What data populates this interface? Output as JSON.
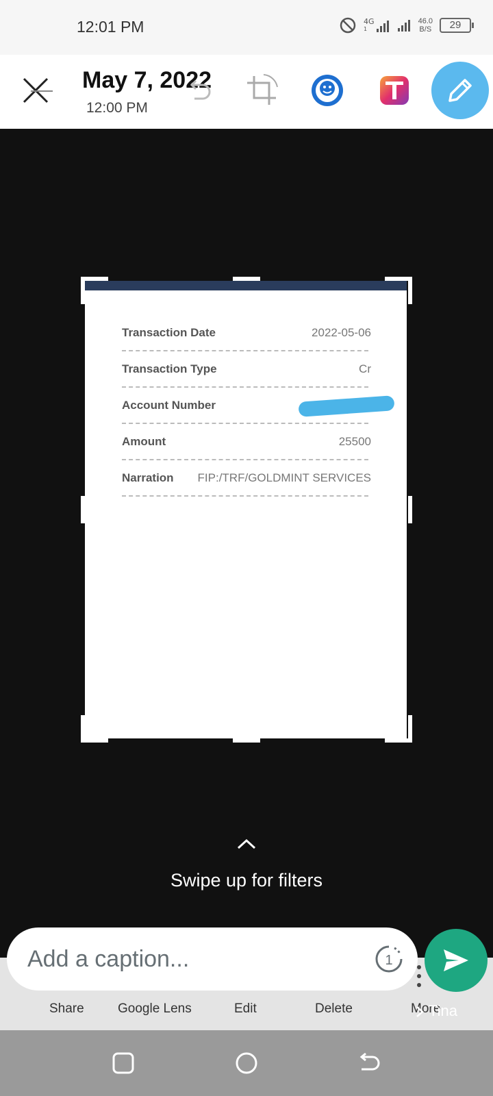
{
  "status_bar": {
    "time": "12:01 PM",
    "network_1": "4G",
    "network_sub": "1",
    "speed_value": "46.0",
    "speed_unit": "B/S",
    "battery": "29"
  },
  "header": {
    "date": "May 7, 2022",
    "time": "12:00 PM",
    "icons": [
      "close-icon",
      "undo-icon",
      "crop-rotate-icon",
      "sticker-icon",
      "text-icon",
      "pencil-icon"
    ],
    "accent_color": "#5bb9ee"
  },
  "document": {
    "rows": [
      {
        "label": "Transaction Date",
        "value": "2022-05-06"
      },
      {
        "label": "Transaction Type",
        "value": "Cr"
      },
      {
        "label": "Account Number",
        "value": ""
      },
      {
        "label": "Amount",
        "value": "25500"
      },
      {
        "label": "Narration",
        "value": "FIP:/TRF/GOLDMINT SERVICES"
      }
    ],
    "redaction_color": "#4bb4e8"
  },
  "filters_hint": "Swipe up for filters",
  "gallery_toolbar": {
    "items": [
      "Share",
      "Google Lens",
      "Edit",
      "Delete",
      "More"
    ]
  },
  "recipient": "Tina",
  "caption": {
    "placeholder": "Add a caption...",
    "timer_label": "1"
  },
  "send_color": "#1ea781",
  "nav": {
    "icons": [
      "recents-icon",
      "home-icon",
      "back-icon"
    ]
  }
}
